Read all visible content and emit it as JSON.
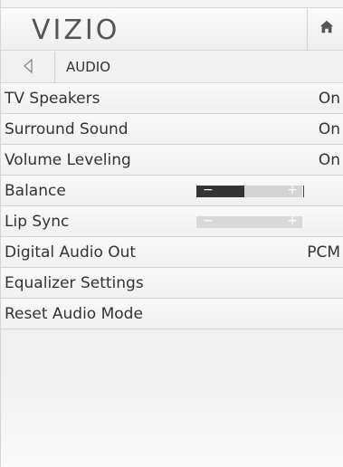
{
  "header": {
    "logo": "VIZIO",
    "home_icon": "home-icon"
  },
  "breadcrumb": {
    "back_icon": "back-arrow-icon",
    "title": "AUDIO"
  },
  "menu": {
    "items": [
      {
        "label": "TV Speakers",
        "value": "On"
      },
      {
        "label": "Surround Sound",
        "value": "On"
      },
      {
        "label": "Volume Leveling",
        "value": "On"
      },
      {
        "label": "Balance",
        "slider_level": 0.45,
        "minus": "−",
        "plus": "+"
      },
      {
        "label": "Lip Sync",
        "slider_level": 0.0,
        "minus": "−",
        "plus": "+"
      },
      {
        "label": "Digital Audio Out",
        "value": "PCM"
      },
      {
        "label": "Equalizer Settings"
      },
      {
        "label": "Reset Audio Mode"
      }
    ]
  }
}
